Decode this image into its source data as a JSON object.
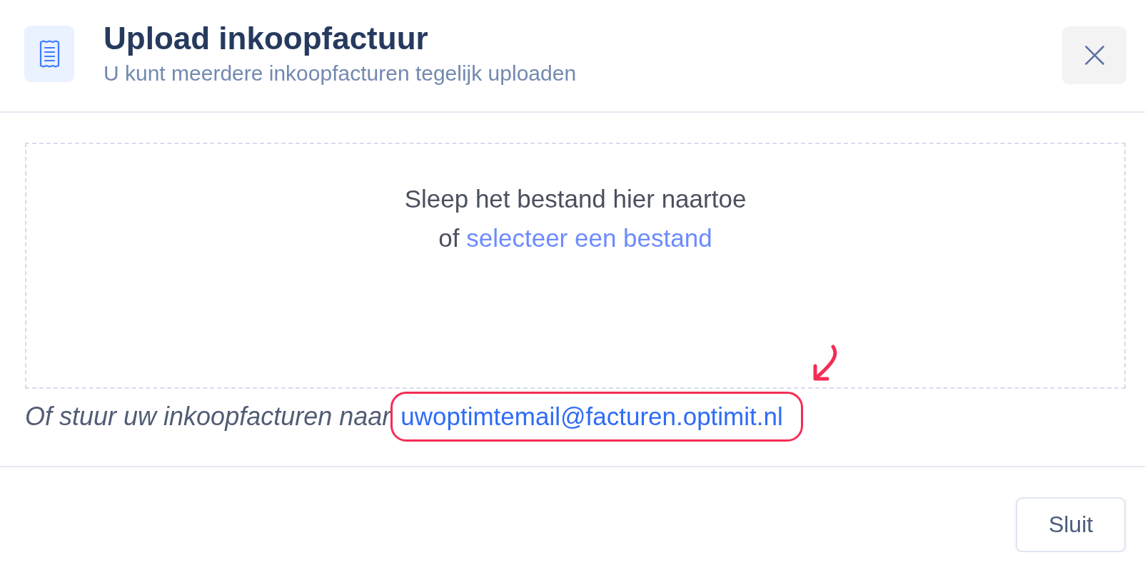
{
  "header": {
    "title": "Upload inkoopfactuur",
    "subtitle": "U kunt meerdere inkoopfacturen tegelijk uploaden"
  },
  "dropzone": {
    "prompt": "Sleep het bestand hier naartoe",
    "alternative": "of",
    "select_link": "selecteer een bestand"
  },
  "email_hint": {
    "text": "Of stuur uw inkoopfacturen naar",
    "address": "uwoptimtemail@facturen.optimit.nl",
    "highlighted": true
  },
  "footer": {
    "buttons": [
      {
        "label": "Sluit"
      }
    ]
  }
}
